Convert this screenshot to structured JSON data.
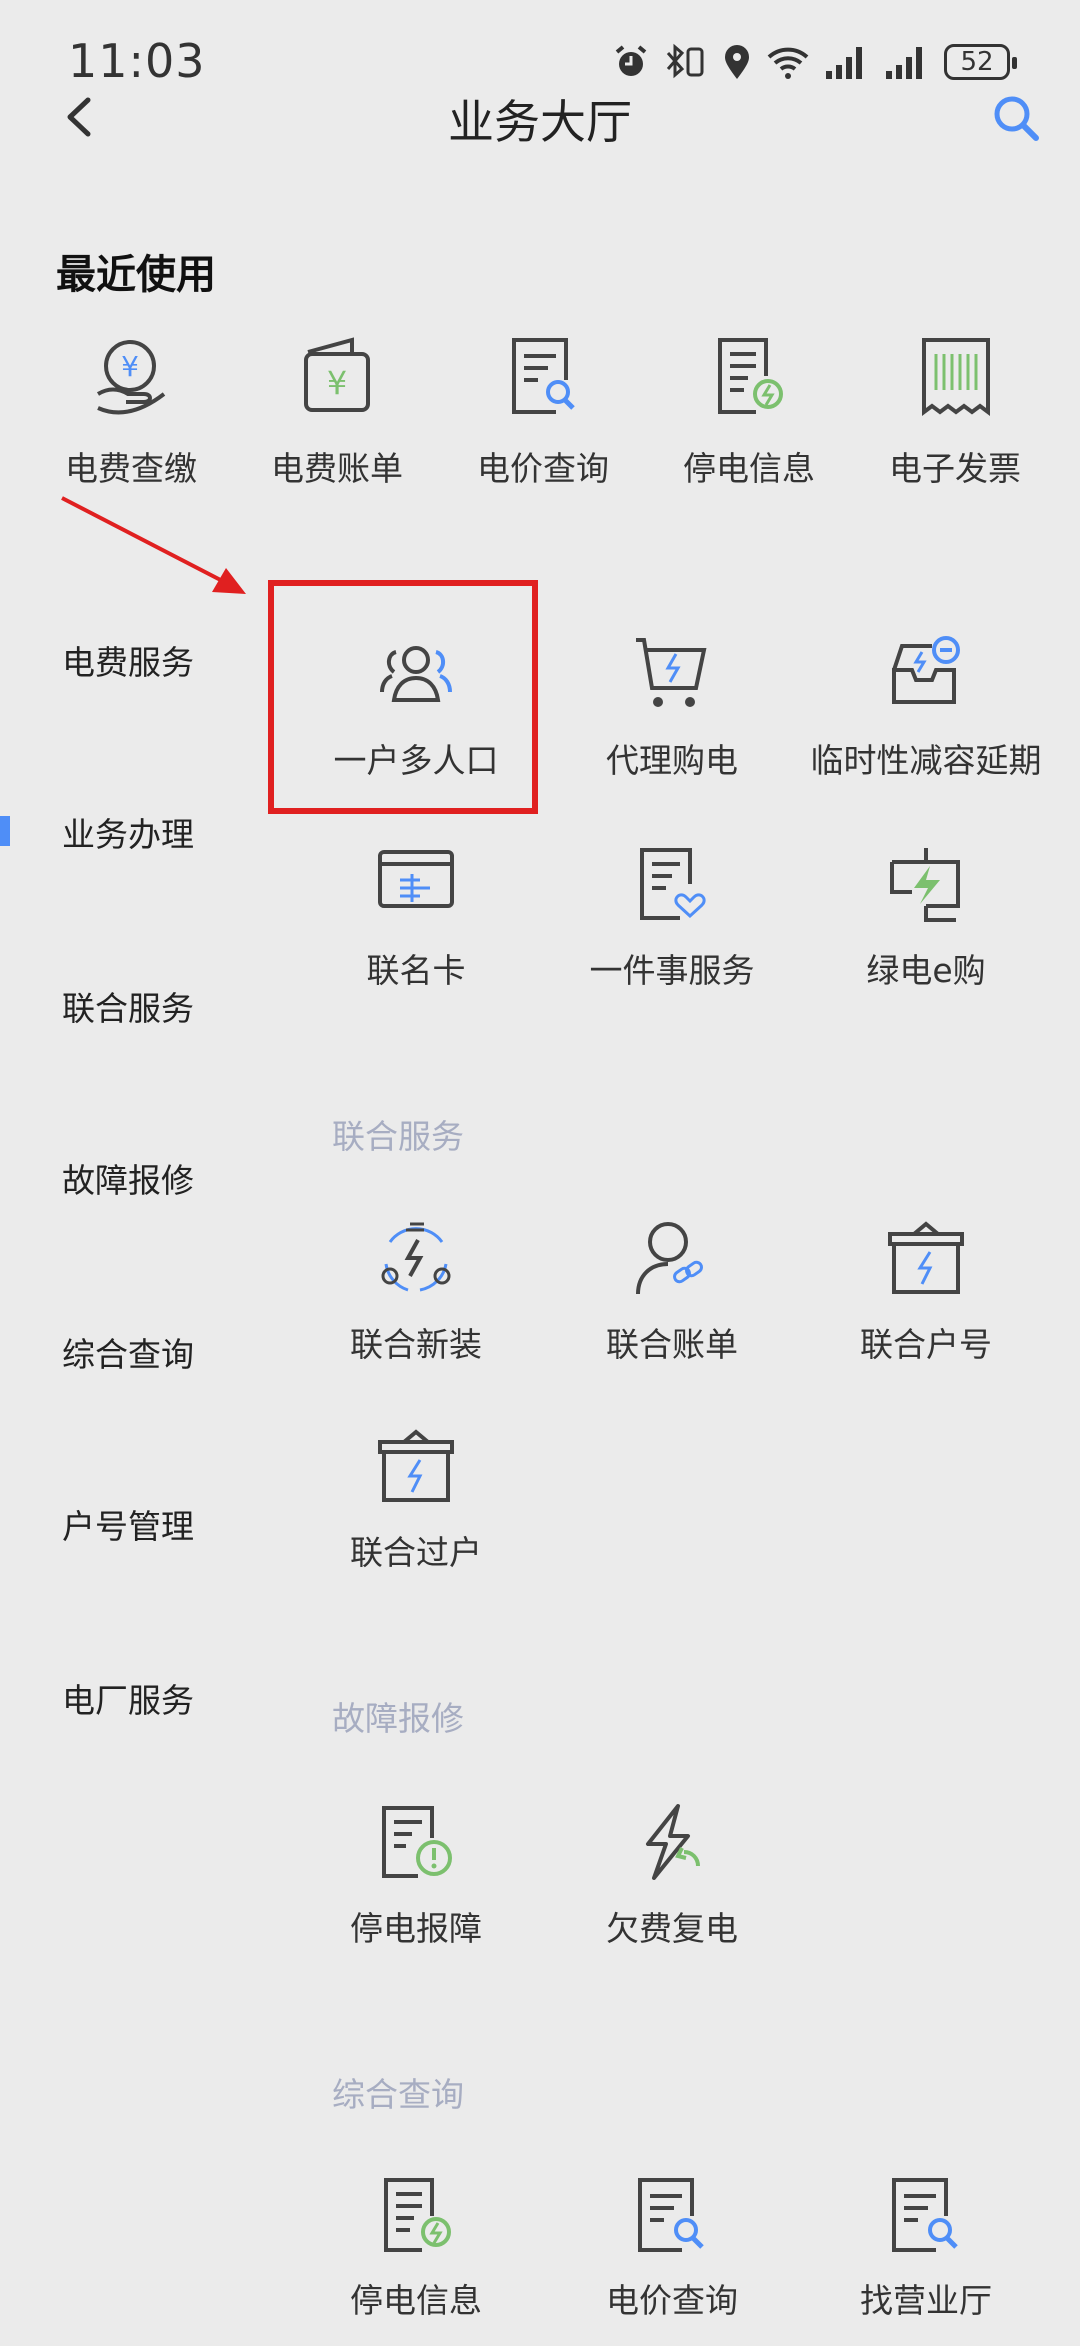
{
  "status_bar": {
    "time": "11:03",
    "battery": "52"
  },
  "header": {
    "title": "业务大厅"
  },
  "recent": {
    "title": "最近使用",
    "items": [
      {
        "label": "电费查缴",
        "icon": "yuan-hand-icon"
      },
      {
        "label": "电费账单",
        "icon": "wallet-yuan-icon"
      },
      {
        "label": "电价查询",
        "icon": "doc-search-icon"
      },
      {
        "label": "停电信息",
        "icon": "doc-bolt-icon"
      },
      {
        "label": "电子发票",
        "icon": "invoice-barcode-icon"
      }
    ]
  },
  "sidebar": {
    "items": [
      {
        "label": "电费服务"
      },
      {
        "label": "业务办理",
        "active": true
      },
      {
        "label": "联合服务"
      },
      {
        "label": "故障报修"
      },
      {
        "label": "综合查询"
      },
      {
        "label": "户号管理"
      },
      {
        "label": "电厂服务"
      }
    ]
  },
  "business": {
    "items": [
      {
        "label": "一户多人口",
        "icon": "users-icon"
      },
      {
        "label": "代理购电",
        "icon": "cart-bolt-icon"
      },
      {
        "label": "临时性减容延期",
        "icon": "tray-minus-icon"
      },
      {
        "label": "联名卡",
        "icon": "card-icon"
      },
      {
        "label": "一件事服务",
        "icon": "doc-heart-icon"
      },
      {
        "label": "绿电e购",
        "icon": "green-bolt-icon"
      }
    ]
  },
  "joint": {
    "title": "联合服务",
    "items": [
      {
        "label": "联合新装",
        "icon": "cycle-bolt-icon"
      },
      {
        "label": "联合账单",
        "icon": "user-link-icon"
      },
      {
        "label": "联合户号",
        "icon": "box-bolt-icon"
      },
      {
        "label": "联合过户",
        "icon": "box-bolt-icon"
      }
    ]
  },
  "repair": {
    "title": "故障报修",
    "items": [
      {
        "label": "停电报障",
        "icon": "doc-alert-icon"
      },
      {
        "label": "欠费复电",
        "icon": "bolt-return-icon"
      }
    ]
  },
  "query": {
    "title": "综合查询",
    "items": [
      {
        "label": "停电信息",
        "icon": "doc-bolt-icon"
      },
      {
        "label": "电价查询",
        "icon": "doc-search-icon"
      },
      {
        "label": "找营业厅",
        "icon": "doc-search-icon"
      }
    ]
  },
  "colors": {
    "accent": "#4f8ef7",
    "green": "#7cc06e",
    "highlight": "#e02020",
    "section": "#a7adc2"
  }
}
